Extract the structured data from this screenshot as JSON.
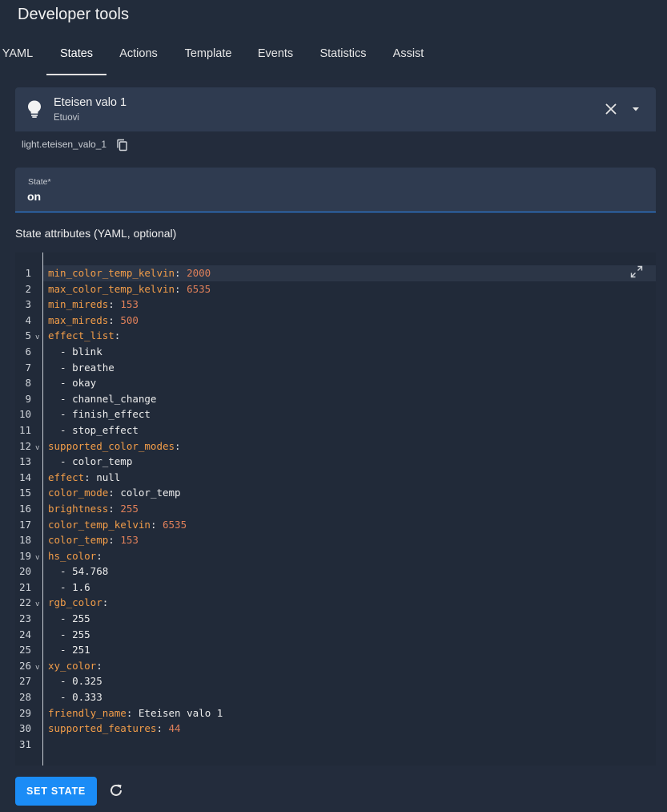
{
  "header": {
    "title": "Developer tools"
  },
  "tabs": [
    {
      "label": "YAML"
    },
    {
      "label": "States"
    },
    {
      "label": "Actions"
    },
    {
      "label": "Template"
    },
    {
      "label": "Events"
    },
    {
      "label": "Statistics"
    },
    {
      "label": "Assist"
    }
  ],
  "entity": {
    "name": "Eteisen valo 1",
    "area": "Etuovi",
    "id": "light.eteisen_valo_1",
    "icon": "lightbulb-icon"
  },
  "state": {
    "label": "State*",
    "value": "on"
  },
  "attributes": {
    "label": "State attributes (YAML, optional)",
    "lines": [
      [
        {
          "t": "min_color_temp_kelvin",
          "c": "k"
        },
        {
          "t": ": ",
          "c": "p"
        },
        {
          "t": "2000",
          "c": "n"
        }
      ],
      [
        {
          "t": "max_color_temp_kelvin",
          "c": "k"
        },
        {
          "t": ": ",
          "c": "p"
        },
        {
          "t": "6535",
          "c": "n"
        }
      ],
      [
        {
          "t": "min_mireds",
          "c": "k"
        },
        {
          "t": ": ",
          "c": "p"
        },
        {
          "t": "153",
          "c": "n"
        }
      ],
      [
        {
          "t": "max_mireds",
          "c": "k"
        },
        {
          "t": ": ",
          "c": "p"
        },
        {
          "t": "500",
          "c": "n"
        }
      ],
      [
        {
          "t": "effect_list",
          "c": "k"
        },
        {
          "t": ":",
          "c": "p"
        }
      ],
      [
        {
          "t": "  - blink",
          "c": "v"
        }
      ],
      [
        {
          "t": "  - breathe",
          "c": "v"
        }
      ],
      [
        {
          "t": "  - okay",
          "c": "v"
        }
      ],
      [
        {
          "t": "  - channel_change",
          "c": "v"
        }
      ],
      [
        {
          "t": "  - finish_effect",
          "c": "v"
        }
      ],
      [
        {
          "t": "  - stop_effect",
          "c": "v"
        }
      ],
      [
        {
          "t": "supported_color_modes",
          "c": "k"
        },
        {
          "t": ":",
          "c": "p"
        }
      ],
      [
        {
          "t": "  - color_temp",
          "c": "v"
        }
      ],
      [
        {
          "t": "effect",
          "c": "k"
        },
        {
          "t": ": ",
          "c": "p"
        },
        {
          "t": "null",
          "c": "v"
        }
      ],
      [
        {
          "t": "color_mode",
          "c": "k"
        },
        {
          "t": ": ",
          "c": "p"
        },
        {
          "t": "color_temp",
          "c": "v"
        }
      ],
      [
        {
          "t": "brightness",
          "c": "k"
        },
        {
          "t": ": ",
          "c": "p"
        },
        {
          "t": "255",
          "c": "n"
        }
      ],
      [
        {
          "t": "color_temp_kelvin",
          "c": "k"
        },
        {
          "t": ": ",
          "c": "p"
        },
        {
          "t": "6535",
          "c": "n"
        }
      ],
      [
        {
          "t": "color_temp",
          "c": "k"
        },
        {
          "t": ": ",
          "c": "p"
        },
        {
          "t": "153",
          "c": "n"
        }
      ],
      [
        {
          "t": "hs_color",
          "c": "k"
        },
        {
          "t": ":",
          "c": "p"
        }
      ],
      [
        {
          "t": "  - 54.768",
          "c": "v"
        }
      ],
      [
        {
          "t": "  - 1.6",
          "c": "v"
        }
      ],
      [
        {
          "t": "rgb_color",
          "c": "k"
        },
        {
          "t": ":",
          "c": "p"
        }
      ],
      [
        {
          "t": "  - 255",
          "c": "v"
        }
      ],
      [
        {
          "t": "  - 255",
          "c": "v"
        }
      ],
      [
        {
          "t": "  - 251",
          "c": "v"
        }
      ],
      [
        {
          "t": "xy_color",
          "c": "k"
        },
        {
          "t": ":",
          "c": "p"
        }
      ],
      [
        {
          "t": "  - 0.325",
          "c": "v"
        }
      ],
      [
        {
          "t": "  - 0.333",
          "c": "v"
        }
      ],
      [
        {
          "t": "friendly_name",
          "c": "k"
        },
        {
          "t": ": ",
          "c": "p"
        },
        {
          "t": "Eteisen valo 1",
          "c": "v"
        }
      ],
      [
        {
          "t": "supported_features",
          "c": "k"
        },
        {
          "t": ": ",
          "c": "p"
        },
        {
          "t": "44",
          "c": "n"
        }
      ],
      []
    ],
    "fold_lines": [
      5,
      12,
      19,
      22,
      26
    ]
  },
  "actions": {
    "set_state_label": "SET STATE"
  },
  "colors": {
    "accent": "#1b8cf6",
    "key": "#f29d49",
    "number": "#e0805a"
  }
}
